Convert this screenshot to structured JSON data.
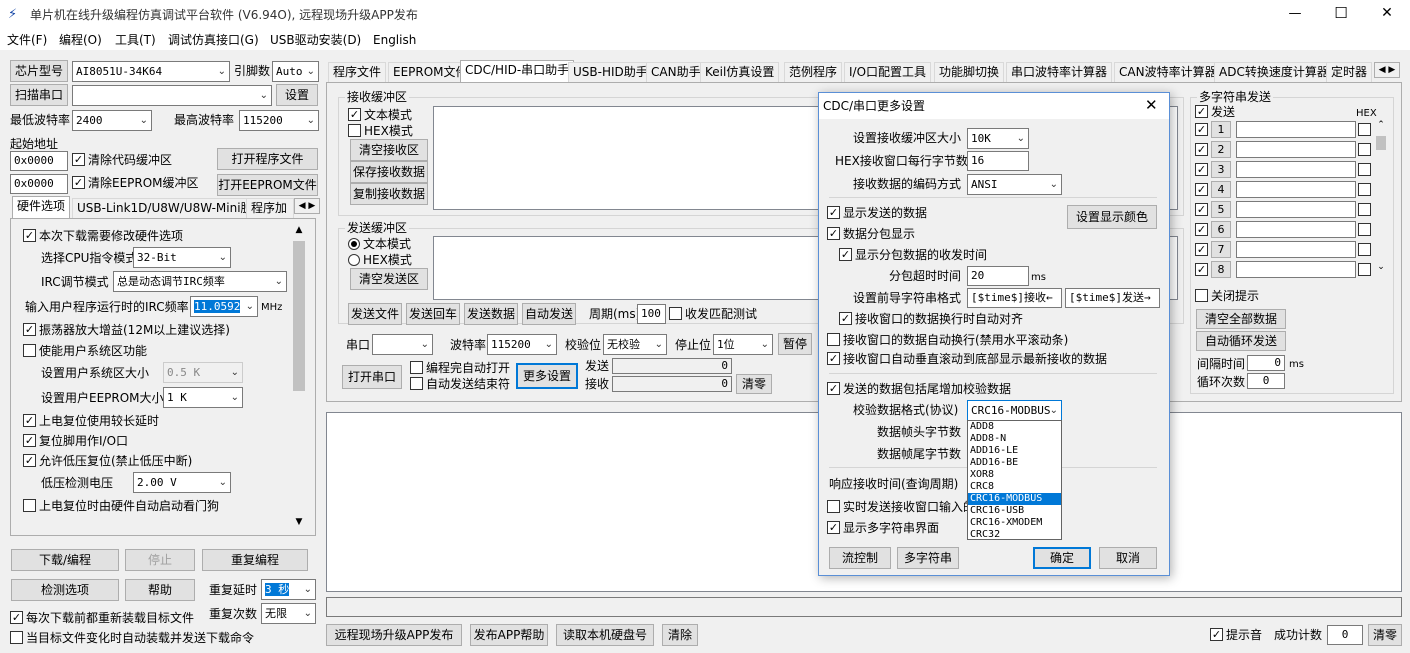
{
  "window": {
    "title": "单片机在线升级编程仿真调试平台软件 (V6.94O), 远程现场升级APP发布",
    "minimize": "—",
    "maximize": "☐",
    "close": "✕"
  },
  "menu": [
    "文件(F)",
    "编程(O)",
    "工具(T)",
    "调试仿真接口(G)",
    "USB驱动安装(D)",
    "English"
  ],
  "left": {
    "chip_label": "芯片型号",
    "chip": "AI8051U-34K64",
    "pin_label": "引脚数",
    "pin": "Auto",
    "scan_btn": "扫描串口",
    "port": "",
    "settings_btn": "设置",
    "min_baud_label": "最低波特率",
    "min_baud": "2400",
    "max_baud_label": "最高波特率",
    "max_baud": "115200",
    "start_addr_label": "起始地址",
    "addr1": "0x0000",
    "clear_code": "清除代码缓冲区",
    "open_prog": "打开程序文件",
    "addr2": "0x0000",
    "clear_eeprom": "清除EEPROM缓冲区",
    "open_eeprom": "打开EEPROM文件",
    "tabs": [
      "硬件选项",
      "USB-Link1D/U8W/U8W-Mini脱机",
      "程序加"
    ],
    "hw_opts": {
      "modify": "本次下载需要修改硬件选项",
      "cpu_label": "选择CPU指令模式",
      "cpu": "32-Bit",
      "irc_label": "IRC调节模式",
      "irc": "总是动态调节IRC频率",
      "freq_label": "输入用户程序运行时的IRC频率",
      "freq": "11.0592",
      "freq_unit": "MHz",
      "osc": "振荡器放大增益(12M以上建议选择)",
      "user_sys": "使能用户系统区功能",
      "sys_size_label": "设置用户系统区大小",
      "sys_size": "0.5 K",
      "eeprom_label": "设置用户EEPROM大小",
      "eeprom": "1   K",
      "long_delay": "上电复位使用较长延时",
      "reset_io": "复位脚用作I/O口",
      "low_v": "允许低压复位(禁止低压中断)",
      "lv_label": "低压检测电压",
      "lv": "2.00 V",
      "wdt": "上电复位时由硬件自动启动看门狗"
    },
    "download_btn": "下载/编程",
    "stop_btn": "停止",
    "reprog_btn": "重复编程",
    "detect_btn": "检测选项",
    "help_btn": "帮助",
    "repeat_delay_label": "重复延时",
    "repeat_delay": "3 秒",
    "repeat_count_label": "重复次数",
    "repeat_count": "无限",
    "reload_each": "每次下载前都重新装载目标文件",
    "auto_reload": "当目标文件变化时自动装载并发送下载命令"
  },
  "tabs": [
    "程序文件",
    "EEPROM文件",
    "CDC/HID-串口助手",
    "USB-HID助手",
    "CAN助手",
    "Keil仿真设置",
    "范例程序",
    "I/O口配置工具",
    "功能脚切换",
    "串口波特率计算器",
    "CAN波特率计算器",
    "ADC转换速度计算器",
    "定时器"
  ],
  "serial": {
    "rx_group": "接收缓冲区",
    "rx_text": "文本模式",
    "rx_hex": "HEX模式",
    "clear_rx": "清空接收区",
    "save_rx": "保存接收数据",
    "copy_rx": "复制接收数据",
    "tx_group": "发送缓冲区",
    "tx_text": "文本模式",
    "tx_hex": "HEX模式",
    "clear_tx": "清空发送区",
    "send_file": "发送文件",
    "send_cr": "发送回车",
    "send_data": "发送数据",
    "auto_send": "自动发送",
    "period_label": "周期(ms)",
    "period": "100",
    "match": "收发匹配测试",
    "port_label": "串口",
    "port": "",
    "baud_label": "波特率",
    "baud": "115200",
    "parity_label": "校验位",
    "parity": "无校验",
    "stop_label": "停止位",
    "stop": "1位",
    "pause": "暂停",
    "open_port": "打开串口",
    "auto_open": "编程完自动打开",
    "auto_close": "自动发送结束符",
    "more": "更多设置",
    "send_label": "发送",
    "send_count": "0",
    "recv_label": "接收",
    "recv_count": "0",
    "clear": "清零"
  },
  "multi": {
    "title": "多字符串发送",
    "send_hdr": "发送",
    "hex_hdr": "HEX",
    "rows": [
      "1",
      "2",
      "3",
      "4",
      "5",
      "6",
      "7",
      "8"
    ],
    "close_tip": "关闭提示",
    "clear_all": "清空全部数据",
    "auto_loop": "自动循环发送",
    "interval_label": "间隔时间",
    "interval": "0",
    "ms": "ms",
    "loop_label": "循环次数",
    "loop": "0"
  },
  "bottom": {
    "publish": "远程现场升级APP发布",
    "publish_help": "发布APP帮助",
    "read_disk": "读取本机硬盘号",
    "clear": "清除",
    "sound": "提示音",
    "success_label": "成功计数",
    "success": "0",
    "reset": "清零"
  },
  "dialog": {
    "title": "CDC/串口更多设置",
    "rxbuf_label": "设置接收缓冲区大小",
    "rxbuf": "10K",
    "hexbytes_label": "HEX接收窗口每行字节数",
    "hexbytes": "16",
    "enc_label": "接收数据的编码方式",
    "enc": "ANSI",
    "show_sent": "显示发送的数据",
    "set_color": "设置显示颜色",
    "packet": "数据分包显示",
    "packet_time": "显示分包数据的收发时间",
    "timeout_label": "分包超时时间",
    "timeout": "20",
    "timeout_unit": "ms",
    "prefix_label": "设置前导字符串格式",
    "prefix_rx": "[$time$]接收←",
    "prefix_tx": "[$time$]发送→",
    "newline": "接收窗口的数据换行时自动对齐",
    "wrap": "接收窗口的数据自动换行(禁用水平滚动条)",
    "autoscroll": "接收窗口自动垂直滚动到底部显示最新接收的数据",
    "checksum": "发送的数据包括尾增加校验数据",
    "fmt_label": "校验数据格式(协议)",
    "fmt": "CRC16-MODBUS",
    "head_label": "数据帧头字节数",
    "tail_label": "数据帧尾字节数",
    "resp_label": "响应接收时间(查询周期)",
    "realtime": "实时发送接收窗口输入的",
    "show_multi": "显示多字符串界面",
    "flow": "流控制",
    "multistr": "多字符串",
    "ok": "确定",
    "cancel": "取消",
    "dropdown": [
      "ADD8",
      "ADD8-N",
      "ADD16-LE",
      "ADD16-BE",
      "XOR8",
      "CRC8",
      "CRC16-MODBUS",
      "CRC16-USB",
      "CRC16-XMODEM",
      "CRC32"
    ],
    "dropdown_selected": "CRC16-MODBUS"
  }
}
